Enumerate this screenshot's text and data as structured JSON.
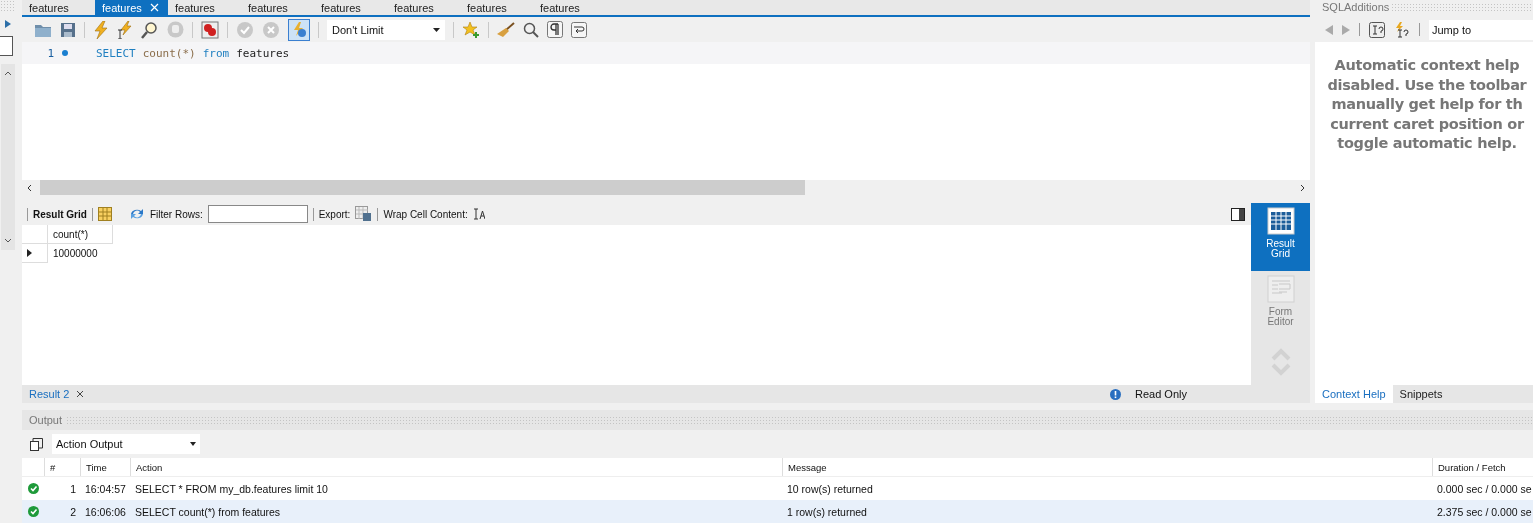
{
  "editor_tabs": [
    {
      "label": "features",
      "selected": false
    },
    {
      "label": "features",
      "selected": true
    },
    {
      "label": "features",
      "selected": false
    },
    {
      "label": "features",
      "selected": false
    },
    {
      "label": "features",
      "selected": false
    },
    {
      "label": "features",
      "selected": false
    },
    {
      "label": "features",
      "selected": false
    },
    {
      "label": "features",
      "selected": false
    }
  ],
  "toolbar": {
    "autocommit_on": true,
    "limit": "Don't Limit"
  },
  "editor": {
    "lines": [
      {
        "number": "1",
        "tokens": [
          {
            "text": "SELECT",
            "kind": "keyword"
          },
          {
            "text": "count(*)",
            "kind": "function"
          },
          {
            "text": "from",
            "kind": "keyword"
          },
          {
            "text": "features",
            "kind": "identifier"
          }
        ]
      }
    ]
  },
  "result_toolbar": {
    "grid_label": "Result Grid",
    "filter_label": "Filter Rows:",
    "export_label": "Export:",
    "wrap_label": "Wrap Cell Content:"
  },
  "result_grid": {
    "columns": [
      "count(*)"
    ],
    "rows": [
      [
        "10000000"
      ]
    ]
  },
  "side_views": [
    {
      "label": "Result Grid",
      "selected": true
    },
    {
      "label": "Form Editor",
      "selected": false
    }
  ],
  "result_tabs": [
    {
      "label": "Result 2",
      "selected": true
    }
  ],
  "read_only": "Read Only",
  "sql_additions": {
    "title": "SQLAdditions",
    "jump_to": "Jump to",
    "help_lines": [
      "Automatic context help",
      "disabled. Use the toolbar",
      "manually get help for th",
      "current caret position or",
      "toggle automatic help."
    ],
    "tabs": [
      {
        "label": "Context Help",
        "selected": true
      },
      {
        "label": "Snippets",
        "selected": false
      }
    ]
  },
  "output": {
    "title": "Output",
    "mode": "Action Output",
    "columns": [
      "#",
      "Time",
      "Action",
      "Message",
      "Duration / Fetch"
    ],
    "rows": [
      {
        "kind": "success",
        "number": "1",
        "time": "16:04:57",
        "action": "SELECT * FROM my_db.features limit 10",
        "message": "10 row(s) returned",
        "duration": "0.000 sec / 0.000 se",
        "selected": false
      },
      {
        "kind": "success",
        "number": "2",
        "time": "16:06:06",
        "action": "SELECT count(*) from features",
        "message": "1 row(s) returned",
        "duration": "2.375 sec / 0.000 se",
        "selected": true
      }
    ]
  }
}
